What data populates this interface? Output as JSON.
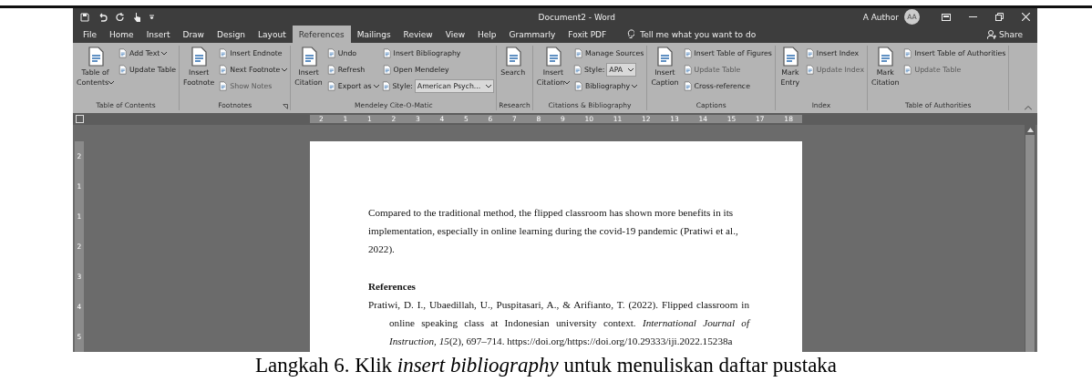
{
  "title_bar": {
    "title": "Document2  -  Word",
    "user": "A Author",
    "avatar_initials": "AA"
  },
  "tabs": [
    {
      "label": "File",
      "selected": false
    },
    {
      "label": "Home",
      "selected": false
    },
    {
      "label": "Insert",
      "selected": false
    },
    {
      "label": "Draw",
      "selected": false
    },
    {
      "label": "Design",
      "selected": false
    },
    {
      "label": "Layout",
      "selected": false
    },
    {
      "label": "References",
      "selected": true
    },
    {
      "label": "Mailings",
      "selected": false
    },
    {
      "label": "Review",
      "selected": false
    },
    {
      "label": "View",
      "selected": false
    },
    {
      "label": "Help",
      "selected": false
    },
    {
      "label": "Grammarly",
      "selected": false
    },
    {
      "label": "Foxit PDF",
      "selected": false
    }
  ],
  "tell_me": {
    "placeholder": "Tell me what you want to do"
  },
  "share": "Share",
  "ribbon_groups": [
    {
      "name": "Table of Contents",
      "launcher": false,
      "columns": [
        {
          "kind": "large",
          "label": "Table of\nContents",
          "dropdown": true
        },
        {
          "kind": "stack",
          "items": [
            {
              "kind": "button",
              "label": "Add Text",
              "dropdown": true,
              "disabled": false
            },
            {
              "kind": "button",
              "label": "Update Table",
              "dropdown": false,
              "disabled": false
            }
          ]
        }
      ]
    },
    {
      "name": "Footnotes",
      "launcher": true,
      "columns": [
        {
          "kind": "large",
          "label": "Insert\nFootnote",
          "dropdown": false
        },
        {
          "kind": "stack",
          "items": [
            {
              "kind": "button",
              "label": "Insert Endnote",
              "dropdown": false,
              "disabled": false
            },
            {
              "kind": "button",
              "label": "Next Footnote",
              "dropdown": true,
              "disabled": false
            },
            {
              "kind": "button",
              "label": "Show Notes",
              "dropdown": false,
              "disabled": true
            }
          ]
        }
      ]
    },
    {
      "name": "Mendeley Cite-O-Matic",
      "launcher": false,
      "columns": [
        {
          "kind": "large",
          "label": "Insert\nCitation",
          "dropdown": false
        },
        {
          "kind": "stack",
          "items": [
            {
              "kind": "button",
              "label": "Undo",
              "dropdown": false,
              "disabled": false
            },
            {
              "kind": "button",
              "label": "Refresh",
              "dropdown": false,
              "disabled": false
            },
            {
              "kind": "button",
              "label": "Export as",
              "dropdown": true,
              "disabled": false
            }
          ]
        },
        {
          "kind": "stack",
          "items": [
            {
              "kind": "button",
              "label": "Insert Bibliography",
              "dropdown": false,
              "disabled": false
            },
            {
              "kind": "button",
              "label": "Open Mendeley",
              "dropdown": false,
              "disabled": false
            },
            {
              "kind": "select",
              "label": "Style:",
              "value": "American Psych..."
            }
          ]
        }
      ]
    },
    {
      "name": "Research",
      "launcher": false,
      "columns": [
        {
          "kind": "large",
          "label": "Search",
          "dropdown": false
        }
      ]
    },
    {
      "name": "Citations & Bibliography",
      "launcher": false,
      "columns": [
        {
          "kind": "large",
          "label": "Insert\nCitation",
          "dropdown": true
        },
        {
          "kind": "stack",
          "items": [
            {
              "kind": "button",
              "label": "Manage Sources",
              "dropdown": false,
              "disabled": false
            },
            {
              "kind": "select",
              "label": "Style:",
              "value": "APA"
            },
            {
              "kind": "button",
              "label": "Bibliography",
              "dropdown": true,
              "disabled": false
            }
          ]
        }
      ]
    },
    {
      "name": "Captions",
      "launcher": false,
      "columns": [
        {
          "kind": "large",
          "label": "Insert\nCaption",
          "dropdown": false
        },
        {
          "kind": "stack",
          "items": [
            {
              "kind": "button",
              "label": "Insert Table of Figures",
              "dropdown": false,
              "disabled": false
            },
            {
              "kind": "button",
              "label": "Update Table",
              "dropdown": false,
              "disabled": true
            },
            {
              "kind": "button",
              "label": "Cross-reference",
              "dropdown": false,
              "disabled": false
            }
          ]
        }
      ]
    },
    {
      "name": "Index",
      "launcher": false,
      "columns": [
        {
          "kind": "large",
          "label": "Mark\nEntry",
          "dropdown": false
        },
        {
          "kind": "stack",
          "items": [
            {
              "kind": "button",
              "label": "Insert Index",
              "dropdown": false,
              "disabled": false
            },
            {
              "kind": "button",
              "label": "Update Index",
              "dropdown": false,
              "disabled": true
            }
          ]
        }
      ]
    },
    {
      "name": "Table of Authorities",
      "launcher": false,
      "columns": [
        {
          "kind": "large",
          "label": "Mark\nCitation",
          "dropdown": false
        },
        {
          "kind": "stack",
          "items": [
            {
              "kind": "button",
              "label": "Insert Table of Authorities",
              "dropdown": false,
              "disabled": false
            },
            {
              "kind": "button",
              "label": "Update Table",
              "dropdown": false,
              "disabled": true
            }
          ]
        }
      ]
    }
  ],
  "horizontal_ruler": [
    "2",
    "1",
    "1",
    "2",
    "3",
    "4",
    "5",
    "6",
    "7",
    "8",
    "9",
    "10",
    "11",
    "12",
    "13",
    "14",
    "15",
    "17",
    "18"
  ],
  "vertical_ruler": [
    "2",
    "1",
    "1",
    "2",
    "3",
    "4",
    "5"
  ],
  "document": {
    "paragraph": "Compared to the traditional method, the flipped classroom has shown more benefits in its implementation, especially in online learning during the covid-19 pandemic (Pratiwi et al., 2022).",
    "heading": "References",
    "reference": "Pratiwi, D. I., Ubaedillah, U., Puspitasari, A., & Arifianto, T. (2022). Flipped classroom in online speaking class at Indonesian university context. *International Journal of Instruction*, *15*(2), 697–714. https://doi.org/https://doi.org/10.29333/iji.2022.15238a"
  },
  "caption": "Langkah 6. Klik *insert bibliography* untuk menuliskan daftar pustaka"
}
